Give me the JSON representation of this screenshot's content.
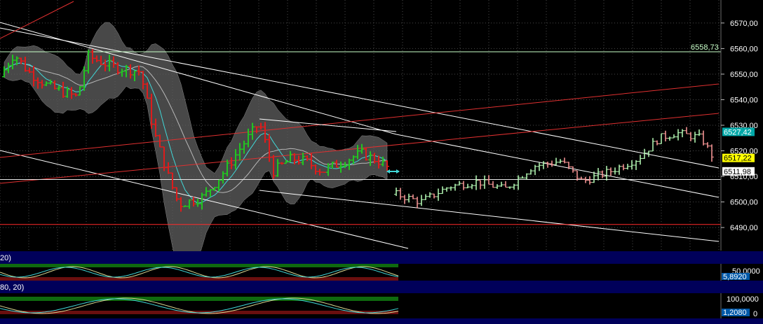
{
  "chart_data": {
    "type": "ohlc",
    "main": {
      "y_range": [
        6481,
        6579
      ],
      "x_range": [
        0,
        1028
      ],
      "y_ticks": [
        {
          "value": 6570,
          "label": "6570,00"
        },
        {
          "value": 6560,
          "label": "6560,00"
        },
        {
          "value": 6550,
          "label": "6550,00"
        },
        {
          "value": 6540,
          "label": "6540,00"
        },
        {
          "value": 6530,
          "label": "6530,00"
        },
        {
          "value": 6520,
          "label": "6520,00"
        },
        {
          "value": 6510,
          "label": "6510,00"
        },
        {
          "value": 6500,
          "label": "6500,00"
        },
        {
          "value": 6490,
          "label": "6490,00"
        }
      ],
      "grid": true,
      "horizontal_lines": [
        {
          "value": 6558.73,
          "label": "6558,73",
          "color": "#c8ffc8"
        },
        {
          "value": 6508.8,
          "label": "",
          "color": "#e8e8e8"
        },
        {
          "value": 6491.2,
          "label": "",
          "color": "#ff2a2a"
        }
      ],
      "price_markers": [
        {
          "value": 6527.42,
          "label": "6527,42",
          "bg": "#00a8a8",
          "fg": "#ffffff"
        },
        {
          "value": 6517.22,
          "label": "6517,22",
          "bg": "#ffff00",
          "fg": "#000000"
        },
        {
          "value": 6511.98,
          "label": "6511,98",
          "bg": "#ffffff",
          "fg": "#000000"
        }
      ],
      "colors": {
        "up_bar": "#22c422",
        "down_bar": "#dd1c1c",
        "up_proj": "#b8ffb8",
        "down_proj": "#ff9a9a",
        "mid_line": "#40d8d8",
        "band": "#5a5a5a"
      }
    },
    "indicators": [
      {
        "label": "20)",
        "visible_value": "5,8920",
        "level_label": "50,0000"
      },
      {
        "label": "80, 20)",
        "visible_value": "1,2080",
        "level_labels": [
          "100,0000",
          "0"
        ]
      }
    ]
  }
}
